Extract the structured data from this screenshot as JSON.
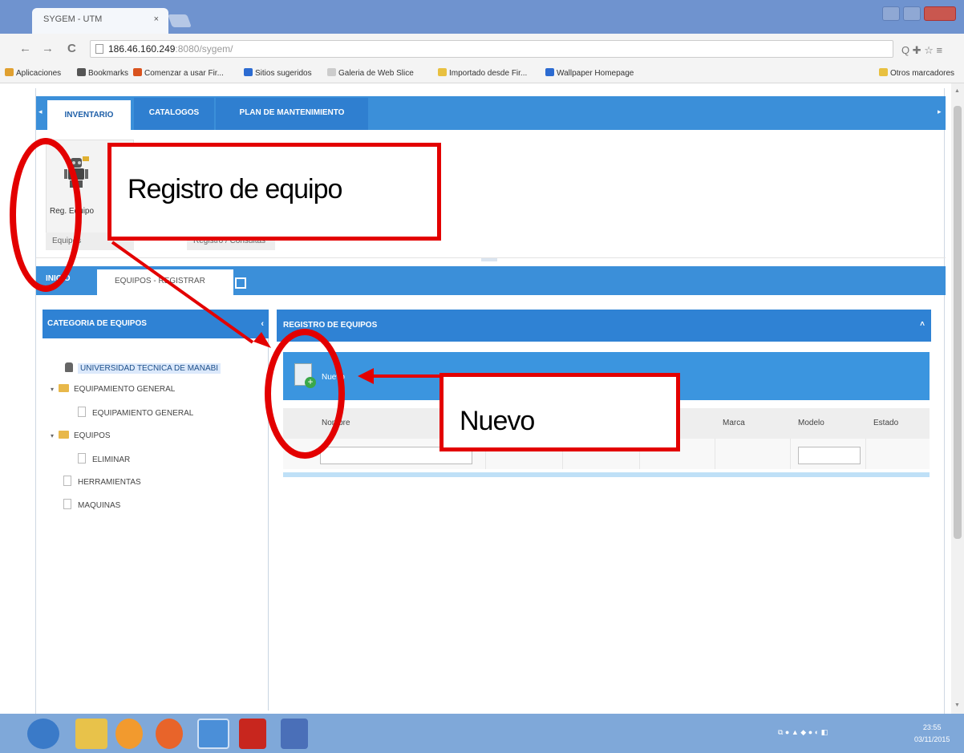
{
  "browser": {
    "tab_title": "SYGEM - UTM",
    "tab_close": "×",
    "url_host": "186.46.160.249",
    "url_rest": ":8080/sygem/",
    "nav": {
      "back": "←",
      "forward": "→",
      "reload": "C"
    },
    "right_icons": "Q ✚ ☆ ≡",
    "bookmarks": [
      {
        "label": "Aplicaciones",
        "color": "#e0a030"
      },
      {
        "label": "Bookmarks",
        "color": "#555555"
      },
      {
        "label": "Comenzar a usar Fir...",
        "color": "#d9531e"
      },
      {
        "label": "Sitios sugeridos",
        "color": "#2c6bd1"
      },
      {
        "label": "Galeria de Web Slice",
        "color": "#cccccc"
      },
      {
        "label": "Importado desde Fir...",
        "color": "#e8c040"
      },
      {
        "label": "Wallpaper Homepage",
        "color": "#2c6bd1"
      }
    ],
    "other_bookmarks": "Otros marcadores"
  },
  "app": {
    "menu_tabs": [
      "INVENTARIO",
      "CATALOGOS",
      "PLAN DE MANTENIMIENTO"
    ],
    "ribbon": {
      "button_label": "Reg. Equipo",
      "group_label_1": "Equipos",
      "group_label_2": "Registro / Consultas"
    },
    "tabs": {
      "home": "INICIO",
      "active": "EQUIPOS - REGISTRAR"
    },
    "left_panel": {
      "title": "CATEGORIA DE EQUIPOS",
      "collapse": "‹",
      "tree": {
        "root": "UNIVERSIDAD TECNICA DE MANABI",
        "n1": "EQUIPAMIENTO GENERAL",
        "n1a": "EQUIPAMIENTO GENERAL",
        "n2": "EQUIPOS",
        "n2a": "ELIMINAR",
        "n3": "HERRAMIENTAS",
        "n4": "MAQUINAS"
      }
    },
    "right_panel": {
      "title": "REGISTRO DE EQUIPOS",
      "caret": "˄",
      "new_label": "Nuevo",
      "columns": [
        "Nombre",
        "Marca",
        "Modelo",
        "Estado"
      ]
    }
  },
  "annotations": {
    "registro": "Registro de equipo",
    "nuevo": "Nuevo",
    "color": "#e30000"
  },
  "taskbar": {
    "clock_time": "23:55",
    "clock_date": "03/11/2015"
  }
}
